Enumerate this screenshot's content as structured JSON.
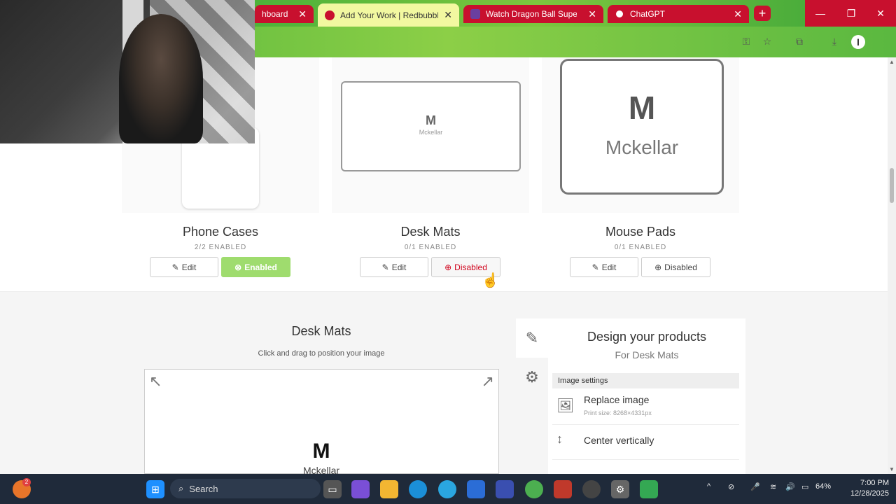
{
  "browser": {
    "tabs": [
      {
        "title": "hboard",
        "active": false
      },
      {
        "title": "Add Your Work | Redbubble",
        "active": true
      },
      {
        "title": "Watch Dragon Ball Super En",
        "active": false
      },
      {
        "title": "ChatGPT",
        "active": false
      }
    ],
    "new_tab": "+",
    "window_buttons": {
      "minimize": "—",
      "restore": "❐",
      "close": "✕"
    },
    "profile_letter": "I"
  },
  "products": [
    {
      "title": "Phone Cases",
      "status": "2/2 ENABLED",
      "edit_label": "Edit",
      "toggle_label": "Enabled",
      "toggle_state": "enabled"
    },
    {
      "title": "Desk Mats",
      "status": "0/1 ENABLED",
      "edit_label": "Edit",
      "toggle_label": "Disabled",
      "toggle_state": "disabled-hover"
    },
    {
      "title": "Mouse Pads",
      "status": "0/1 ENABLED",
      "edit_label": "Edit",
      "toggle_label": "Disabled",
      "toggle_state": "disabled"
    }
  ],
  "brand": {
    "logo_text": "Mckellar",
    "monogram": "M"
  },
  "editor": {
    "canvas_title": "Desk Mats",
    "canvas_hint": "Click and drag to position your image",
    "panel_title": "Design your products",
    "panel_subtitle": "For Desk Mats",
    "section_label": "Image settings",
    "replace_label": "Replace image",
    "print_size": "Print size: 8268×4331px",
    "center_vertical_label": "Center vertically"
  },
  "taskbar": {
    "search_label": "Search",
    "notification_count": "2",
    "battery": "64%",
    "time": "7:00 PM",
    "date": "12/28/2025"
  },
  "colors": {
    "redbubble_red": "#c8102e",
    "enabled_green": "#9fdc6e",
    "disabled_red": "#d0021b"
  }
}
